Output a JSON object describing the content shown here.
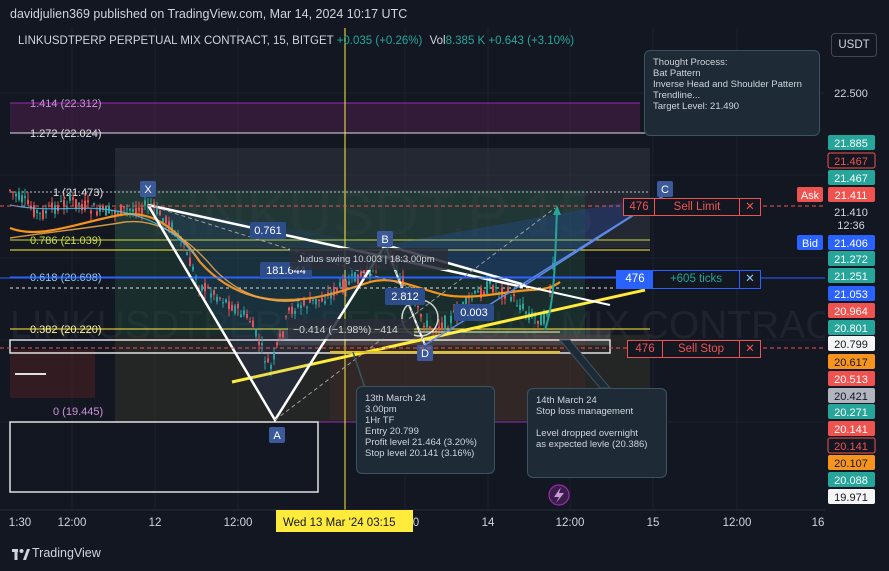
{
  "header": {
    "publisher": "davidjulien369 published on TradingView.com, Mar 14, 2024 10:17 UTC",
    "symbol": "LINKUSDTPERP PERPETUAL MIX CONTRACT, 15, BITGET",
    "change": "+0.035 (+0.26%)",
    "vol_label": "Vol",
    "vol_value": "8.385 K",
    "vol_change": "+0.643 (+3.10%)",
    "currency": "USDT"
  },
  "watermark": {
    "line1": "LINKUSDT.P 15",
    "line2": "LINKUSDTPERP PERPETUAL MIX CONTRACT"
  },
  "notes": {
    "thought": "Thought Process:\nBat Pattern\nInverse Head and Shoulder Pattern\nTrendline...\nTarget Level: 21.490",
    "entry": "13th March 24\n3.00pm\n1Hr TF\nEntry 20.799\nProfit level 21.464 (3.20%)\nStop level 20.141 (3.16%)",
    "stoploss": "14th March 24\nStop loss management\n\nLevel dropped overnight\nas expected levle (20.386)"
  },
  "orders": {
    "sell_limit": {
      "qty": "476",
      "label": "Sell Limit",
      "close": "✕"
    },
    "position": {
      "qty": "476",
      "label": "+605 ticks",
      "close": "✕"
    },
    "sell_stop": {
      "qty": "476",
      "label": "Sell Stop",
      "close": "✕"
    }
  },
  "chart_data": {
    "type": "candlestick",
    "symbol": "LINKUSDT.P",
    "timeframe": "15",
    "fib_levels": [
      {
        "label": "1.414 (22.312)",
        "value": 22.312
      },
      {
        "label": "1.272 (22.024)",
        "value": 22.024
      },
      {
        "label": "1 (21.473)",
        "value": 21.473
      },
      {
        "label": "0.786 (21.039)",
        "value": 21.039
      },
      {
        "label": "0.618 (20.698)",
        "value": 20.698
      },
      {
        "label": "0.382 (20.220)",
        "value": 20.22
      },
      {
        "label": "0 (19.445)",
        "value": 19.445
      }
    ],
    "pattern_points": [
      {
        "label": "X",
        "value": 21.48
      },
      {
        "label": "A",
        "value": 19.45
      },
      {
        "label": "B",
        "value": 21.0
      },
      {
        "label": "C",
        "value": 21.55
      },
      {
        "label": "D",
        "value": 20.4
      }
    ],
    "pattern_labels": {
      "xa_ratio": "0.761",
      "bars": "181.644",
      "swing": "Judus swing 10.003 | 18:3.00pm",
      "bc": "2.812",
      "cd": "0.003",
      "range": "−0.414 (−1.98%) −414"
    },
    "price_axis": {
      "ticks": [
        "22.500",
        "21.885",
        "21.467",
        "21.467",
        "21.411",
        "21.410",
        "21.406",
        "21.272",
        "21.251",
        "21.053",
        "20.964",
        "20.801",
        "20.799",
        "20.617",
        "20.513",
        "20.421",
        "20.271",
        "20.141",
        "20.141",
        "20.107",
        "20.088",
        "19.971"
      ],
      "ask_label": "Ask",
      "ask_value": "21.411",
      "countdown": "12:36",
      "bid_label": "Bid",
      "bid_value": "21.406"
    },
    "time_axis": {
      "ticks": [
        "1:30",
        "12:00",
        "12",
        "12:00",
        "0",
        "14",
        "12:00",
        "15",
        "12:00",
        "16"
      ],
      "current_label": "Wed 13 Mar '24   03:15"
    },
    "colors": {
      "up": "#26a69a",
      "down": "#ef5350",
      "ma_orange": "#f7941d",
      "trend_yellow": "#ffeb3b",
      "fib_purple": "#9c27b0",
      "accent_blue": "#2962ff"
    }
  },
  "footer": {
    "brand": "TradingView"
  }
}
